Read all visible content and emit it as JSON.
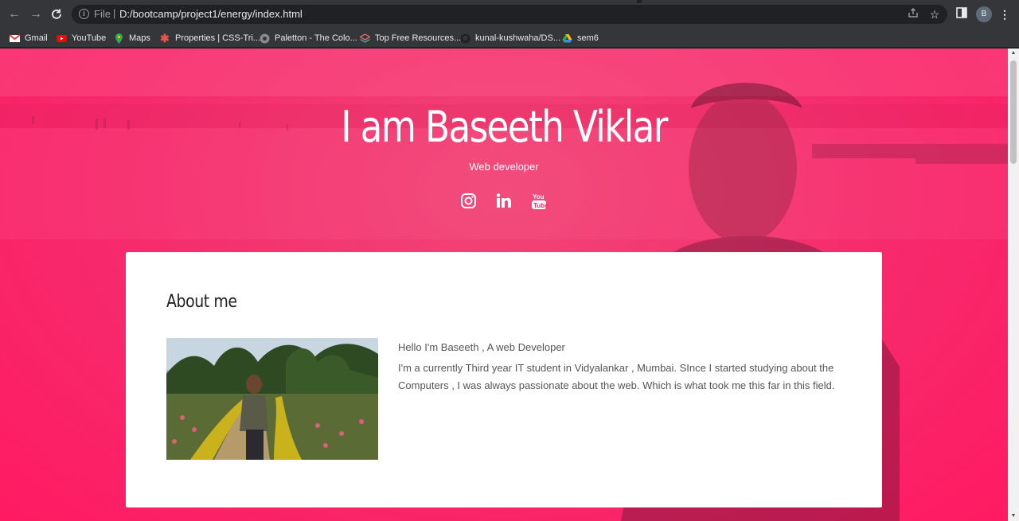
{
  "browser": {
    "scheme": "File",
    "url": "D:/bootcamp/project1/energy/index.html",
    "profile_initial": "B"
  },
  "bookmarks": [
    {
      "label": "Gmail",
      "icon": "gmail-icon"
    },
    {
      "label": "YouTube",
      "icon": "youtube-icon"
    },
    {
      "label": "Maps",
      "icon": "maps-icon"
    },
    {
      "label": "Properties | CSS-Tri...",
      "icon": "css-tricks-icon"
    },
    {
      "label": "Paletton - The Colo...",
      "icon": "paletton-icon"
    },
    {
      "label": "Top Free Resources...",
      "icon": "layers-icon"
    },
    {
      "label": "kunal-kushwaha/DS...",
      "icon": "github-icon"
    },
    {
      "label": "sem6",
      "icon": "google-drive-icon"
    }
  ],
  "hero": {
    "title": "I am Baseeth Viklar",
    "subtitle": "Web developer",
    "socials": [
      "instagram-icon",
      "linkedin-icon",
      "youtube-icon"
    ]
  },
  "about": {
    "heading": "About me",
    "intro": "Hello I'm Baseeth , A web Developer",
    "body": "I'm a currently Third year IT student in Vidyalankar , Mumbai. SInce I started studying about the Computers , I was always passionate about the web. Which is what took me this far in this field."
  },
  "colors": {
    "hero_pink": "#f62a6c",
    "chrome_dark": "#35363a",
    "card_bg": "#ffffff"
  }
}
